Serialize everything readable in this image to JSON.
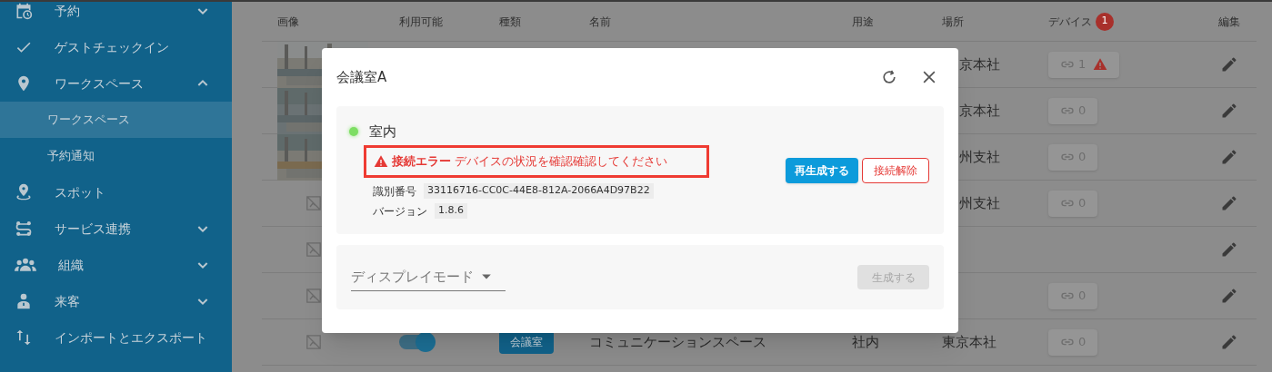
{
  "sidebar": {
    "items": [
      {
        "kind": "group",
        "label": "予約",
        "expanded": false,
        "selected": false
      },
      {
        "kind": "link",
        "label": "ゲストチェックイン",
        "selected": false
      },
      {
        "kind": "group",
        "label": "ワークスペース",
        "expanded": true,
        "selected": false,
        "children": [
          {
            "label": "ワークスペース",
            "selected": true
          },
          {
            "label": "予約通知",
            "selected": false
          }
        ]
      },
      {
        "kind": "link",
        "label": "スポット",
        "selected": false
      },
      {
        "kind": "group",
        "label": "サービス連携",
        "expanded": false,
        "selected": false
      },
      {
        "kind": "group",
        "label": "組織",
        "expanded": false,
        "selected": false
      },
      {
        "kind": "group",
        "label": "来客",
        "expanded": false,
        "selected": false
      },
      {
        "kind": "link",
        "label": "インポートとエクスポート",
        "selected": false
      }
    ]
  },
  "table": {
    "columns": [
      "画像",
      "利用可能",
      "種類",
      "名前",
      "用途",
      "場所",
      "デバイス",
      "編集"
    ],
    "device_alert_count": "1",
    "rows": [
      {
        "place": "京本社",
        "device": {
          "count": "1",
          "warning": true
        }
      },
      {
        "place": "京本社",
        "device": {
          "count": "0",
          "warning": false
        }
      },
      {
        "place": "州支社",
        "device": {
          "count": "0",
          "warning": false
        }
      },
      {
        "kind": "no-image",
        "place": "州支社",
        "device": {
          "count": "0",
          "warning": false
        }
      },
      {
        "kind": "no-image"
      },
      {
        "kind": "no-image",
        "device": {
          "count": "0",
          "warning": false
        }
      },
      {
        "kind": "no-image",
        "available": true,
        "type": "会議室",
        "name": "コミュニケーションスペース",
        "use": "社内",
        "place": "東京本社",
        "device": {
          "count": "0",
          "warning": false
        }
      }
    ]
  },
  "dialog": {
    "title": "会議室A",
    "device": {
      "name": "室内",
      "online": true,
      "error": "**接続エラー** デバイスの状況を確認確認してください",
      "id_label": "識別番号",
      "id": "33116716-CC0C-44E8-812A-2066A4D97B22",
      "version_label": "バージョン",
      "version": "1.8.6",
      "regenerate": "再生成する",
      "disconnect": "接続解除"
    },
    "display": {
      "label": "ディスプレイモード",
      "generate": "生成する",
      "generate_disabled": true
    }
  }
}
